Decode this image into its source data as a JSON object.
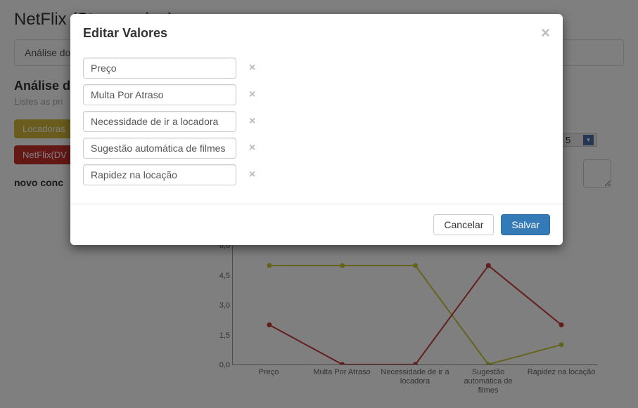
{
  "header": {
    "title": "NetFlix (Streamming)"
  },
  "tabs": {
    "analysis_label": "Análise do"
  },
  "section": {
    "title_prefix": "Análise de",
    "subtitle": "Listes as pri",
    "badge_yellow": "Locadoras",
    "badge_red": "NetFlix(DV",
    "novo": "novo conc"
  },
  "right": {
    "select_value": "5"
  },
  "modal": {
    "title": "Editar Valores",
    "values": [
      "Preço",
      "Multa Por Atraso",
      "Necessidade de ir a locadora",
      "Sugestão automática de filmes",
      "Rapidez na locação"
    ],
    "cancel": "Cancelar",
    "save": "Salvar"
  },
  "chart_data": {
    "type": "line",
    "categories": [
      "Preço",
      "Multa Por Atraso",
      "Necessidade de ir a locadora",
      "Sugestão automática de filmes",
      "Rapidez na locação"
    ],
    "series": [
      {
        "name": "Locadoras",
        "color": "#c9c93a",
        "values": [
          5.0,
          5.0,
          5.0,
          0.0,
          1.0
        ]
      },
      {
        "name": "NetFlix(DVD)",
        "color": "#c93a3a",
        "values": [
          2.0,
          0.0,
          0.0,
          5.0,
          2.0
        ]
      }
    ],
    "ylim": [
      0.0,
      6.0
    ],
    "yticks": [
      0.0,
      1.5,
      3.0,
      4.5,
      6.0
    ],
    "xlabel": "",
    "ylabel": ""
  }
}
